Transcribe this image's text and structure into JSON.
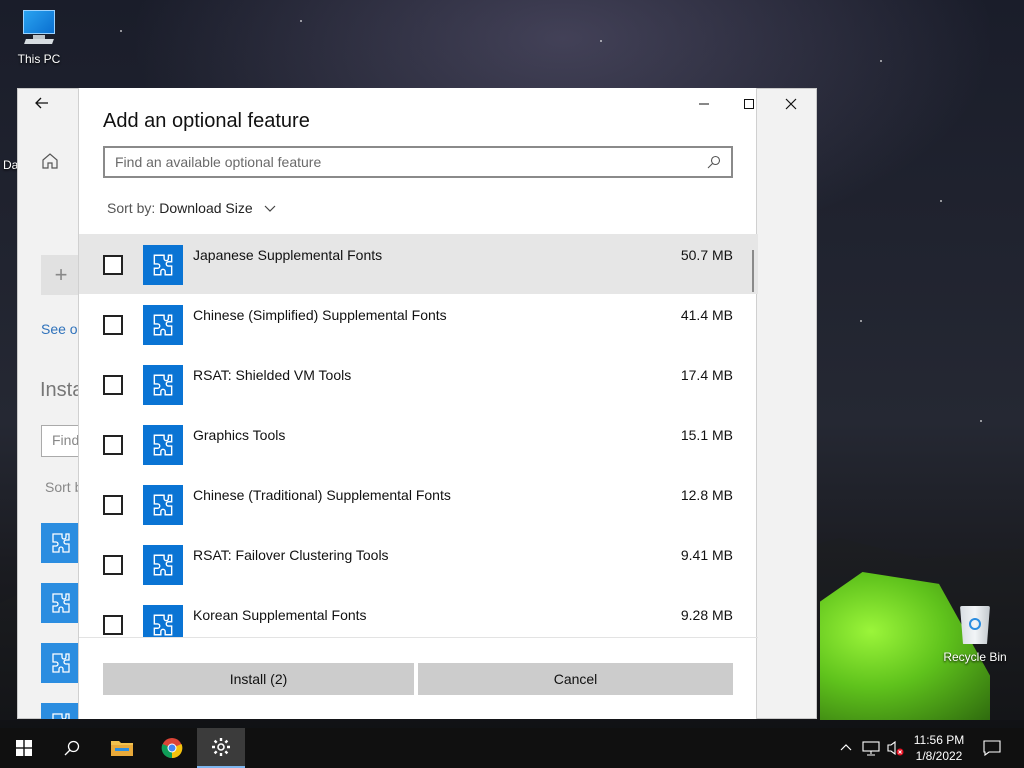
{
  "desktop": {
    "icons": [
      {
        "label": "This PC"
      },
      {
        "label": "Recycle Bin"
      }
    ],
    "partial_label": "Da"
  },
  "background_window": {
    "see_link": "See op",
    "installed_heading": "Insta",
    "find_placeholder": "Find",
    "sort_label": "Sort b"
  },
  "dialog": {
    "title": "Add an optional feature",
    "search": {
      "placeholder": "Find an available optional feature",
      "value": ""
    },
    "sort": {
      "label": "Sort by:",
      "value": "Download Size"
    },
    "features": [
      {
        "name": "Japanese Supplemental Fonts",
        "size": "50.7 MB",
        "checked": false,
        "highlighted": true
      },
      {
        "name": "Chinese (Simplified) Supplemental Fonts",
        "size": "41.4 MB",
        "checked": false,
        "highlighted": false
      },
      {
        "name": "RSAT: Shielded VM Tools",
        "size": "17.4 MB",
        "checked": false,
        "highlighted": false
      },
      {
        "name": "Graphics Tools",
        "size": "15.1 MB",
        "checked": false,
        "highlighted": false
      },
      {
        "name": "Chinese (Traditional) Supplemental Fonts",
        "size": "12.8 MB",
        "checked": false,
        "highlighted": false
      },
      {
        "name": "RSAT: Failover Clustering Tools",
        "size": "9.41 MB",
        "checked": false,
        "highlighted": false
      },
      {
        "name": "Korean Supplemental Fonts",
        "size": "9.28 MB",
        "checked": false,
        "highlighted": false
      }
    ],
    "install_label": "Install (2)",
    "cancel_label": "Cancel"
  },
  "taskbar": {
    "time": "11:56 PM",
    "date": "1/8/2022"
  },
  "colors": {
    "accent": "#0a74d4",
    "selected_row": "#e6e6e6",
    "button": "#cccccc"
  }
}
